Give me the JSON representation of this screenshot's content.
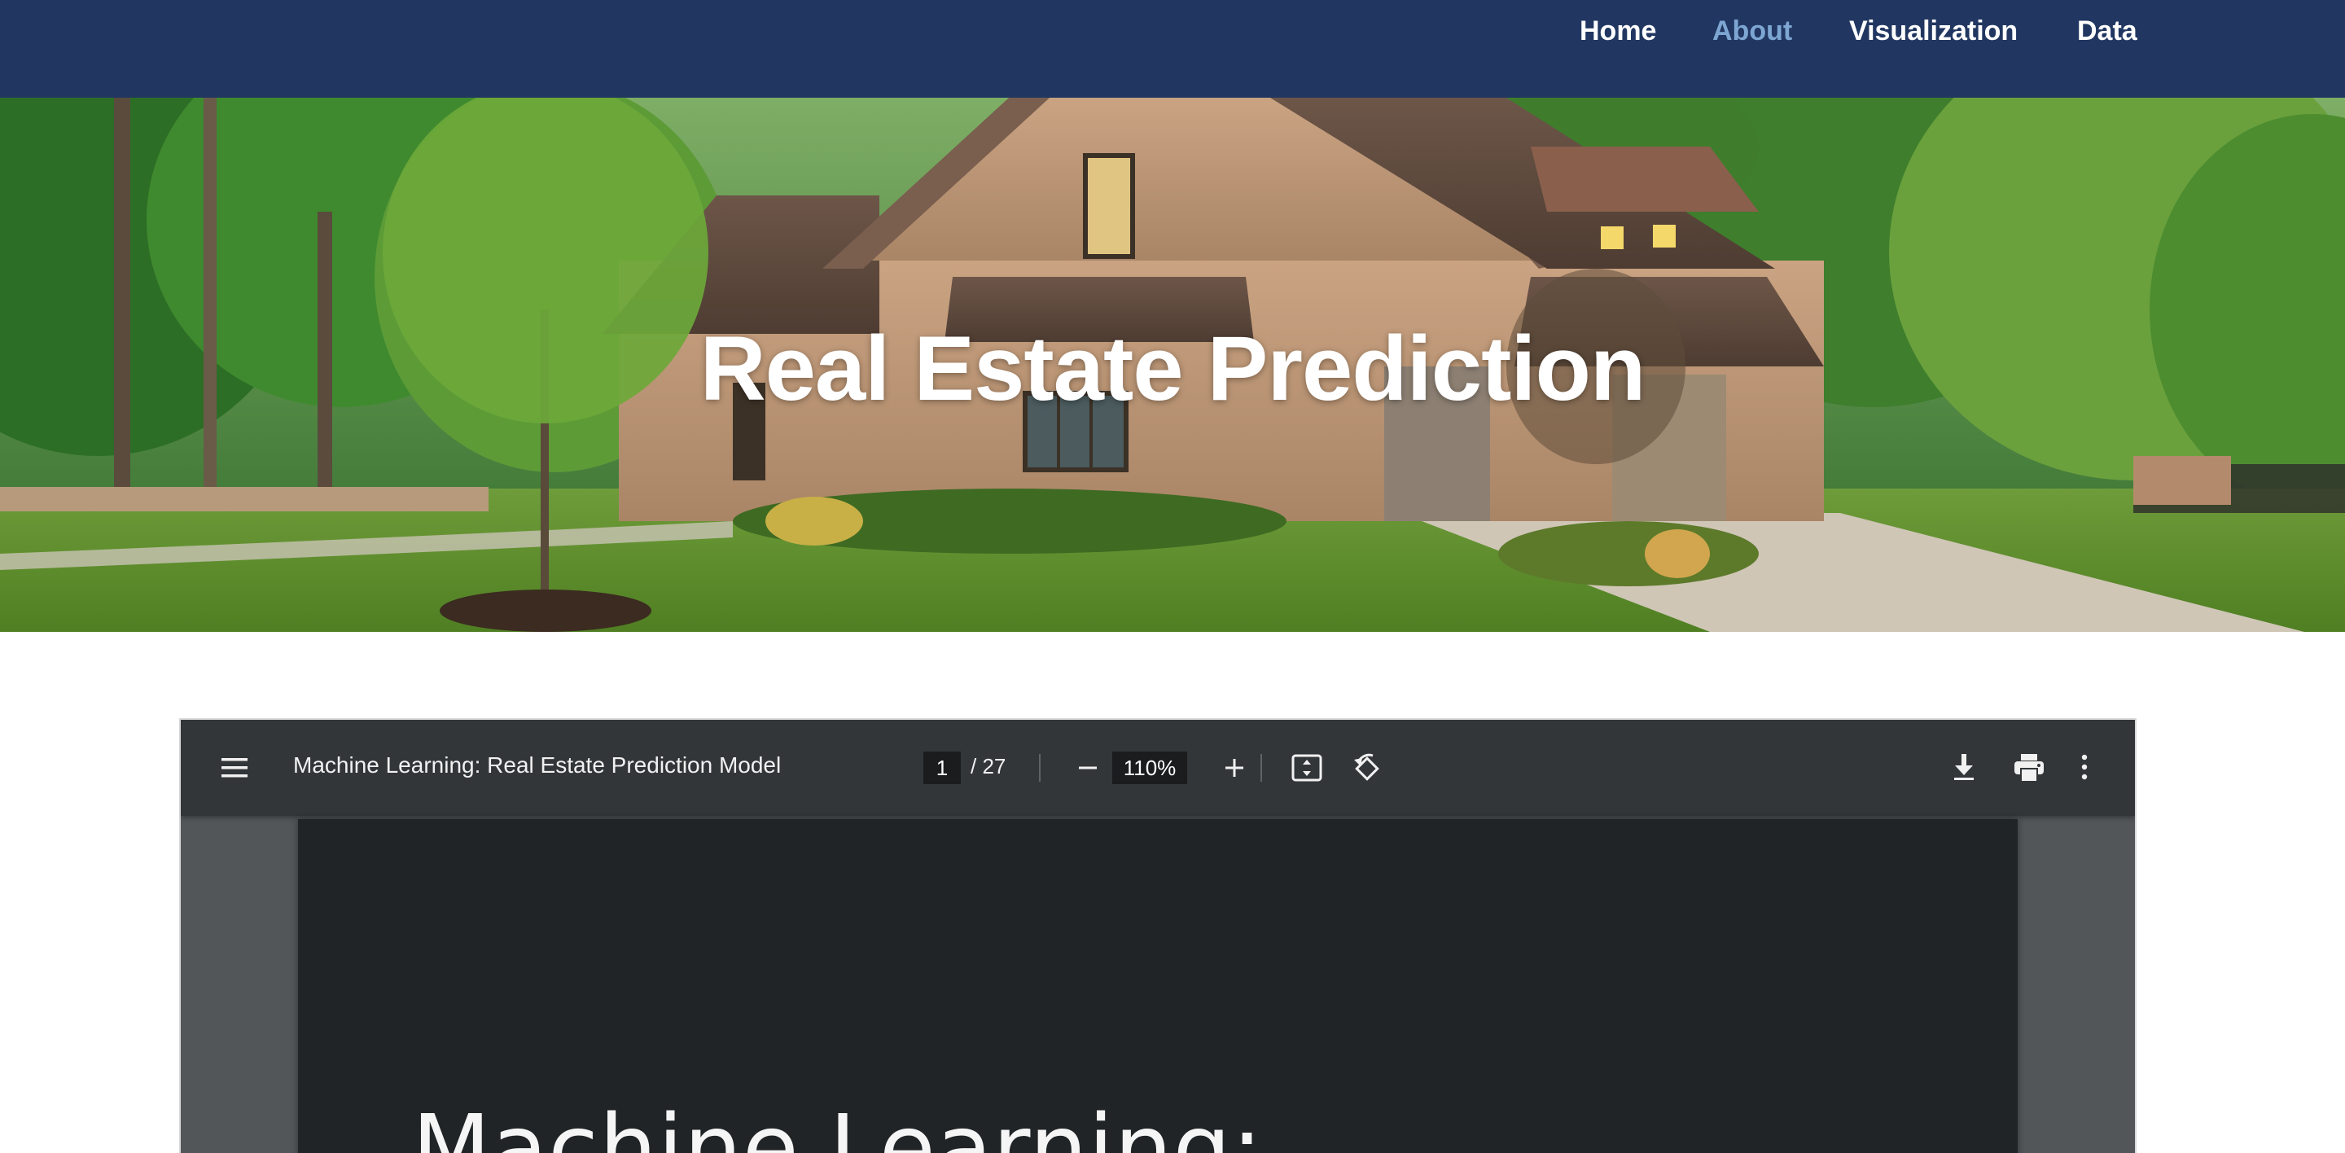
{
  "nav": {
    "links": [
      {
        "label": "Home",
        "active": false
      },
      {
        "label": "About",
        "active": true
      },
      {
        "label": "Visualization",
        "active": false
      },
      {
        "label": "Data",
        "active": false
      }
    ],
    "background": "#213761",
    "active_color": "#7ea6d3"
  },
  "hero": {
    "title": "Real Estate Prediction",
    "image": "brick-house-with-lawn-and-trees"
  },
  "pdf_viewer": {
    "menu_icon": "menu-icon",
    "document_title": "Machine Learning: Real Estate Prediction Model",
    "current_page": "1",
    "total_pages": "/ 27",
    "zoom": "110%",
    "icons": [
      "zoom-out-icon",
      "zoom-in-icon",
      "fit-page-icon",
      "rotate-icon",
      "download-icon",
      "print-icon",
      "more-vert-icon"
    ],
    "page_content": {
      "heading": "Machine Learning:"
    }
  }
}
